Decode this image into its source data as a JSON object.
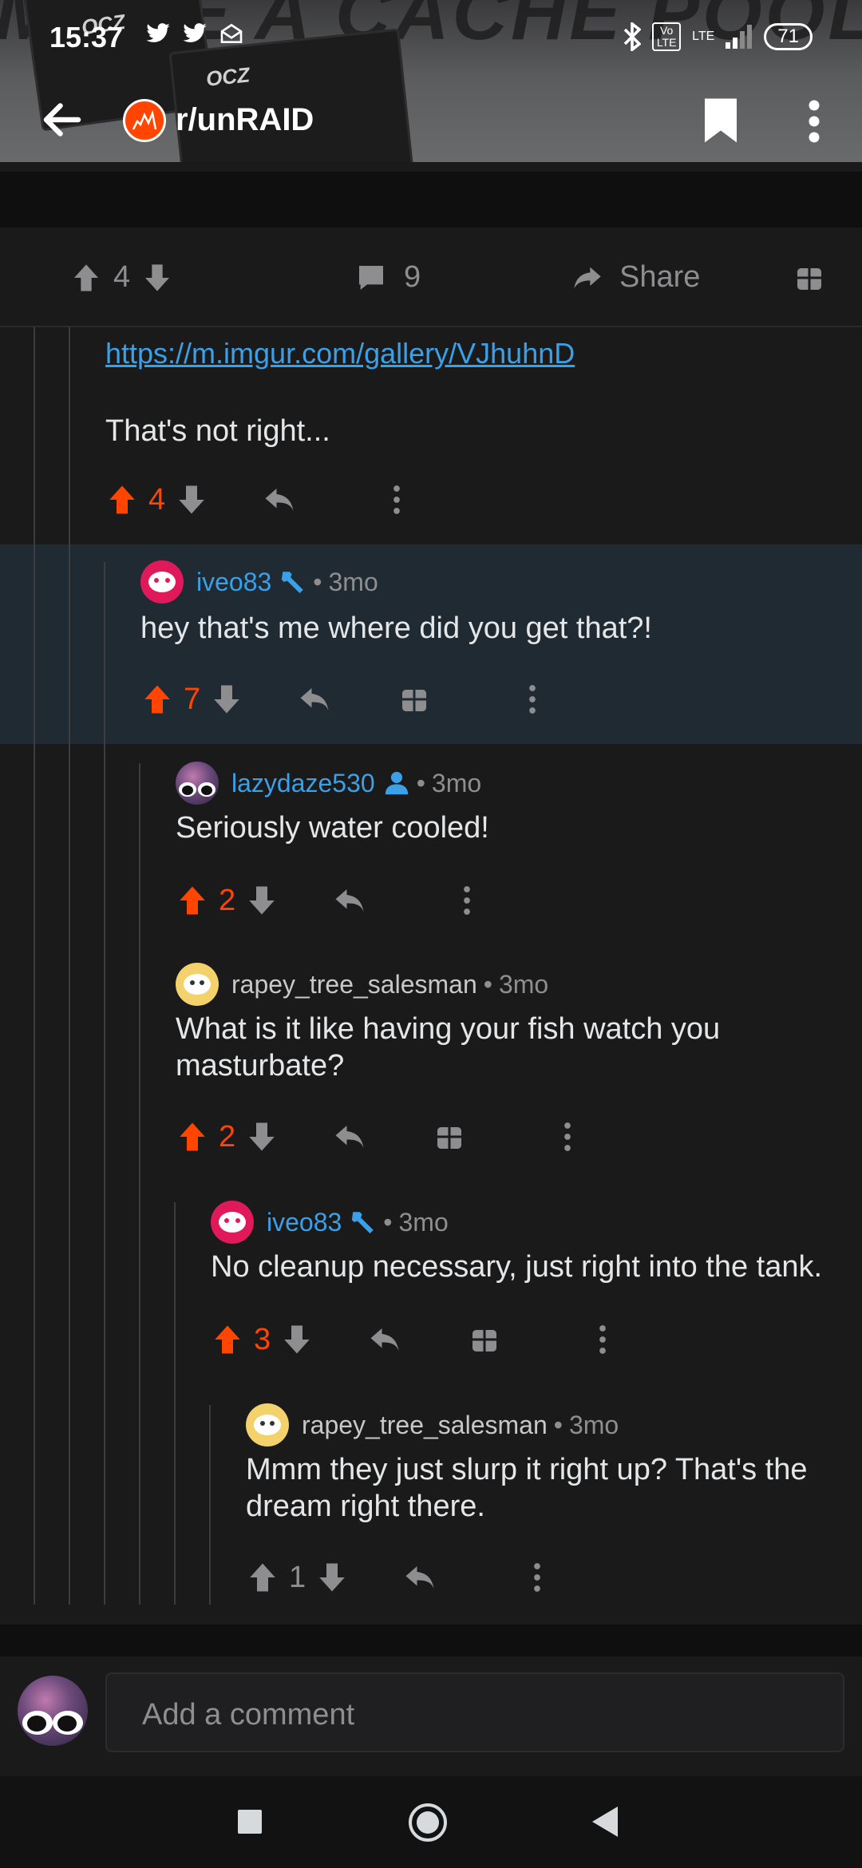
{
  "status_bar": {
    "time": "15:37",
    "battery": "71",
    "lte_label": "LTE",
    "volte_label": "Vo LTE"
  },
  "header": {
    "subreddit": "r/unRAID",
    "banner_text": "OR MAKE A CACHE POOL",
    "ssd_label": "OCZ"
  },
  "post_actions": {
    "upvotes": "4",
    "comments": "9",
    "share_label": "Share"
  },
  "comments": [
    {
      "link": "https://m.imgur.com/gallery/VJhuhnD",
      "body": "That's not right...",
      "votes": "4",
      "voted": true
    },
    {
      "user": "iveo83",
      "age": "3mo",
      "body": "hey that's me where did you get that?!",
      "votes": "7",
      "voted": true,
      "badge": "wrench-icon"
    },
    {
      "user": "lazydaze530",
      "age": "3mo",
      "body": "Seriously water cooled!",
      "votes": "2",
      "voted": true,
      "badge": "user-icon"
    },
    {
      "user": "rapey_tree_salesman",
      "age": "3mo",
      "body": "What is it like having your fish watch you masturbate?",
      "votes": "2",
      "voted": true
    },
    {
      "user": "iveo83",
      "age": "3mo",
      "body": "No cleanup necessary, just right into the tank.",
      "votes": "3",
      "voted": true,
      "badge": "wrench-icon"
    },
    {
      "user": "rapey_tree_salesman",
      "age": "3mo",
      "body": "Mmm they just slurp it right up? That's the dream right there.",
      "votes": "1",
      "voted": false
    }
  ],
  "comment_bar": {
    "placeholder": "Add a comment"
  },
  "colors": {
    "accent_orange": "#ff4500",
    "user_blue": "#3aa0e8",
    "highlight_bg": "#202a33"
  }
}
